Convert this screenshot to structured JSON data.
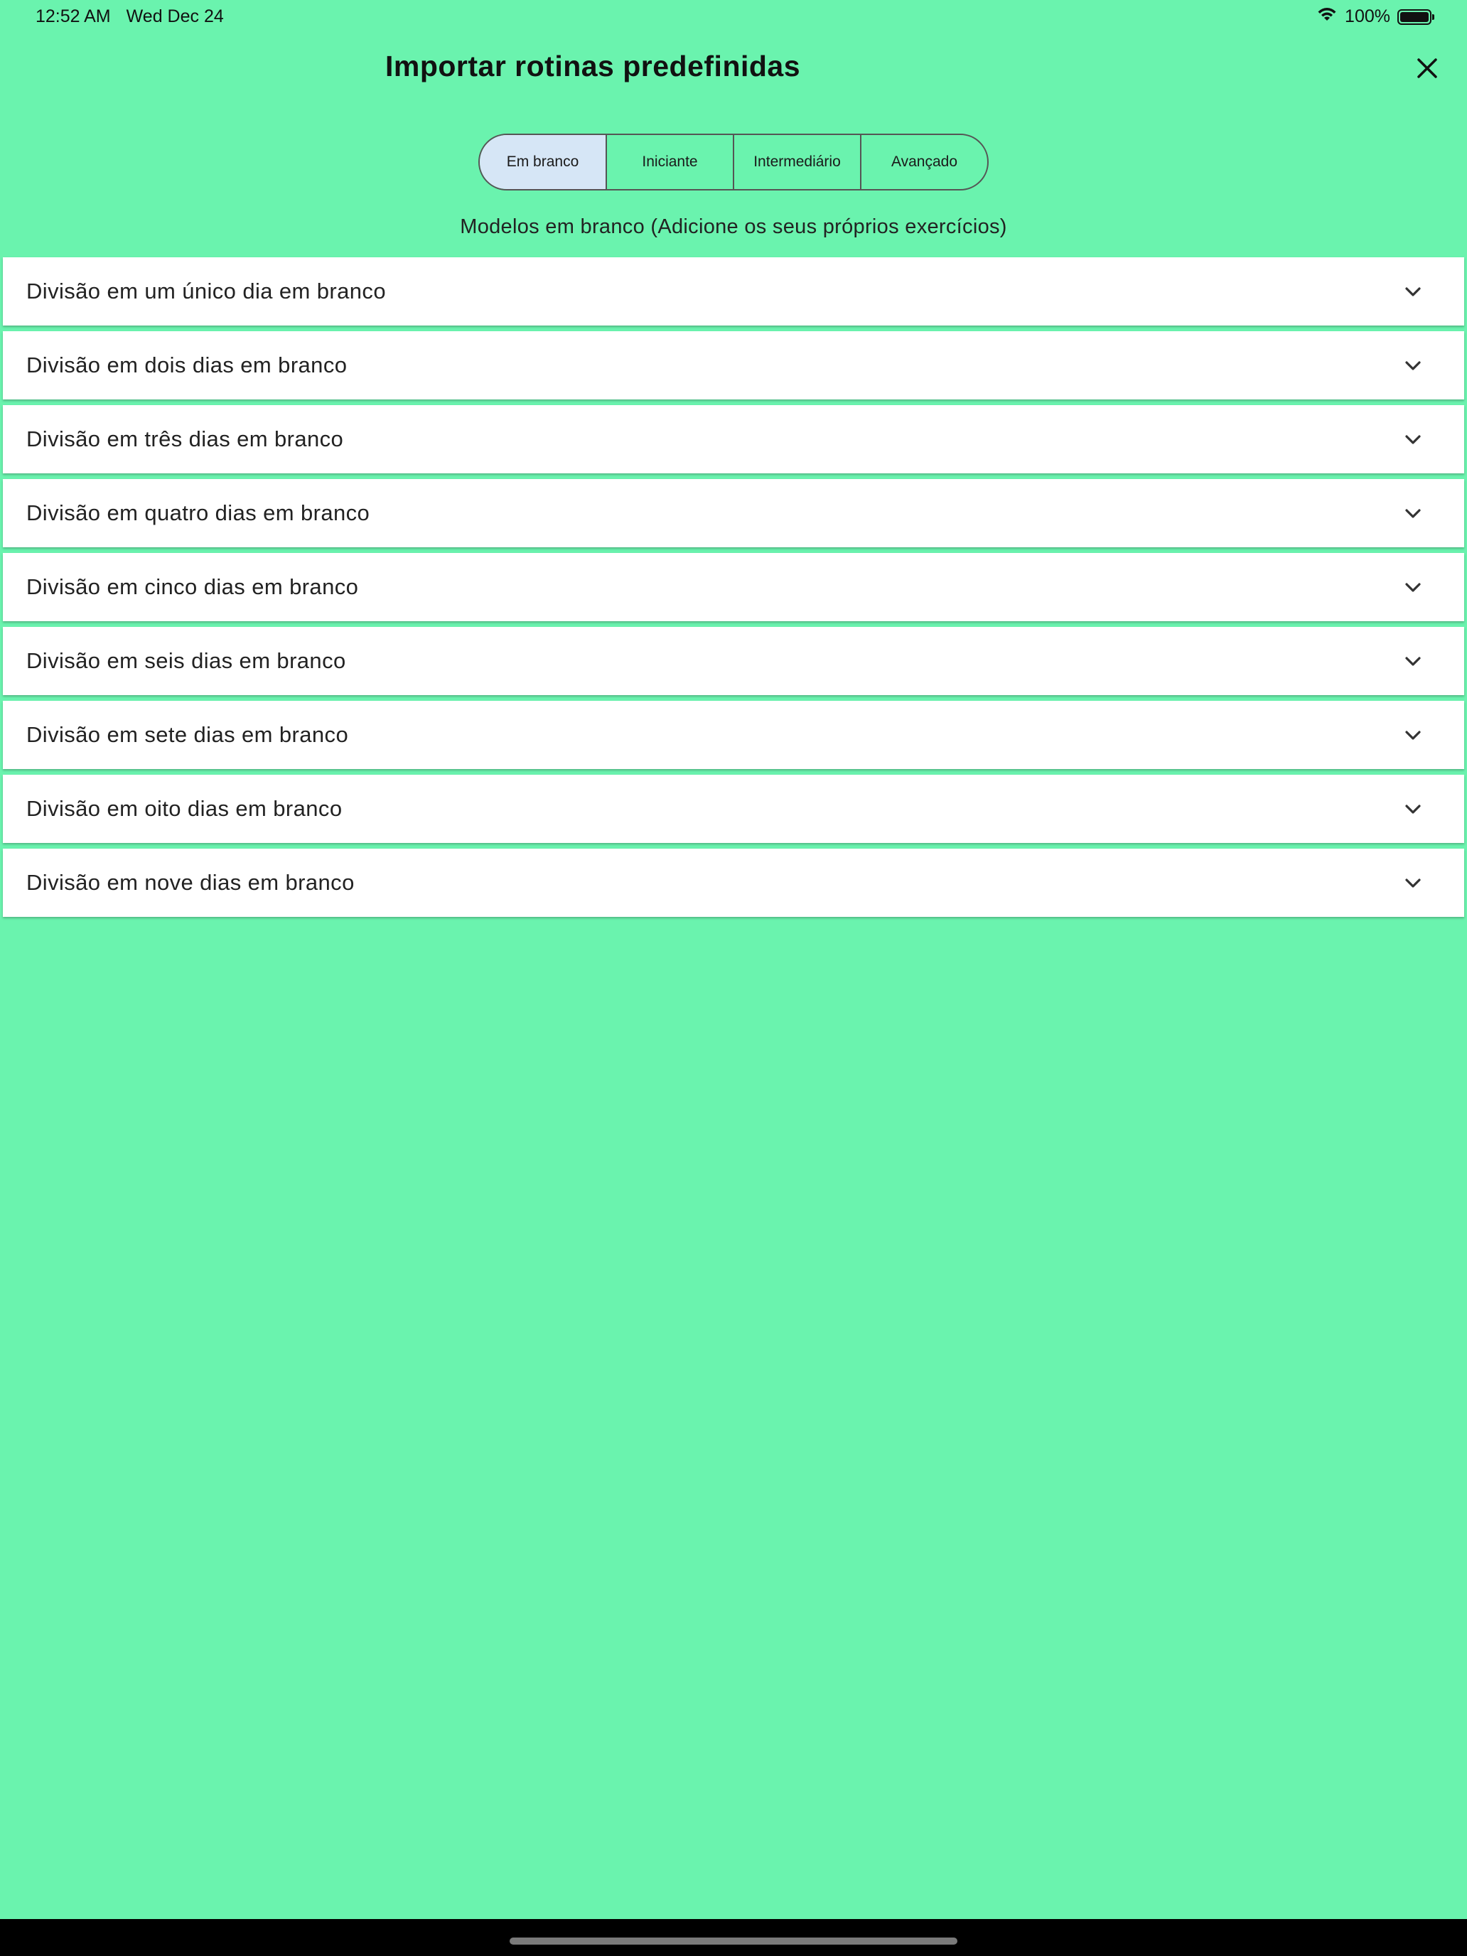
{
  "status_bar": {
    "time": "12:52 AM",
    "date": "Wed Dec 24",
    "battery": "100%",
    "icons": [
      "wifi-icon",
      "battery-icon"
    ]
  },
  "header": {
    "title": "Importar rotinas predefinidas",
    "close_icon": "close-icon"
  },
  "tabs": [
    {
      "label": "Em branco",
      "selected": true
    },
    {
      "label": "Iniciante",
      "selected": false
    },
    {
      "label": "Intermediário",
      "selected": false
    },
    {
      "label": "Avançado",
      "selected": false
    }
  ],
  "subtitle": "Modelos em branco (Adicione os seus próprios exercícios)",
  "routines": [
    {
      "label": "Divisão em um único dia em branco"
    },
    {
      "label": "Divisão em dois dias em branco"
    },
    {
      "label": "Divisão em três dias em branco"
    },
    {
      "label": "Divisão em quatro dias em branco"
    },
    {
      "label": "Divisão em cinco dias em branco"
    },
    {
      "label": "Divisão em seis dias em branco"
    },
    {
      "label": "Divisão em sete dias em branco"
    },
    {
      "label": "Divisão em oito dias em branco"
    },
    {
      "label": "Divisão em nove dias em branco"
    }
  ],
  "colors": {
    "background": "#6af3ae",
    "selected_tab": "#d6e6f6",
    "card": "#ffffff"
  }
}
